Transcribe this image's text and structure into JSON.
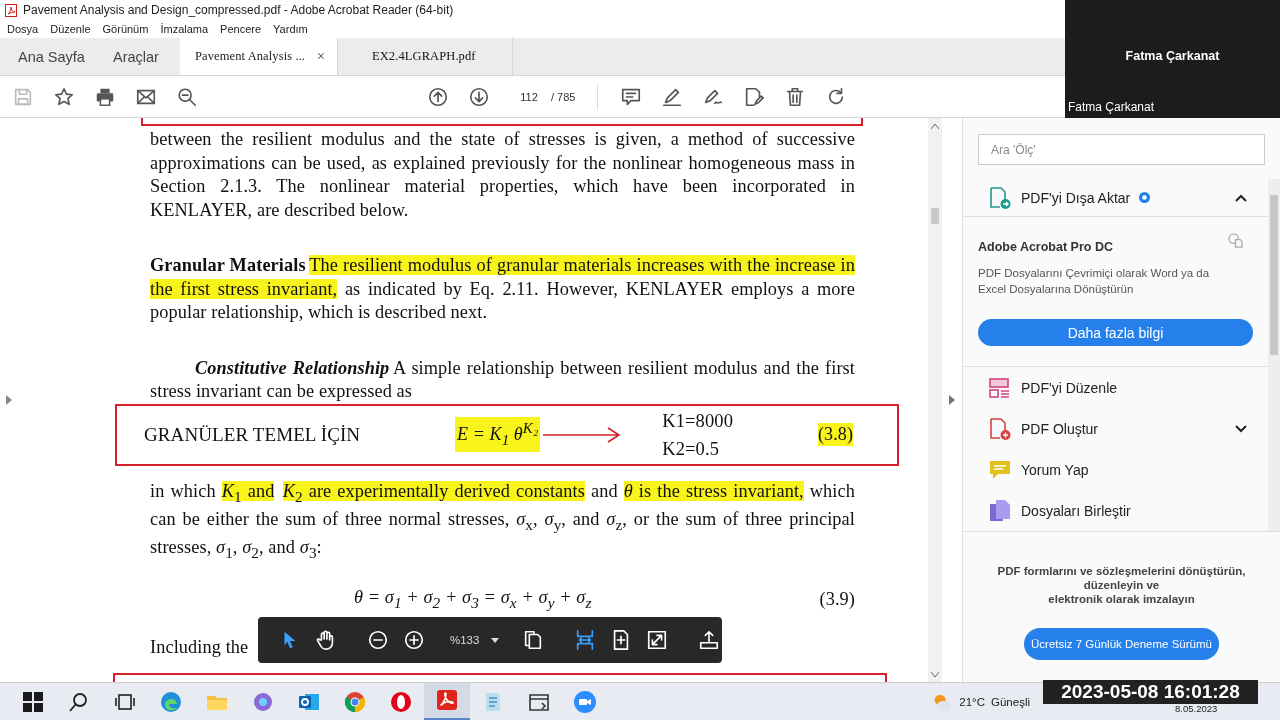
{
  "window": {
    "title": "Pavement Analysis and Design_compressed.pdf - Adobe Acrobat Reader (64-bit)"
  },
  "menu": [
    "Dosya",
    "Düzenle",
    "Görünüm",
    "İmzalama",
    "Pencere",
    "Yardım"
  ],
  "tabs": [
    {
      "label": "Ana Sayfa",
      "kind": "nav",
      "selected": false
    },
    {
      "label": "Araçlar",
      "kind": "nav",
      "selected": false
    },
    {
      "label": "Pavement Analysis ...",
      "kind": "doc",
      "selected": true,
      "close": "×"
    },
    {
      "label": "EX2.4LGRAPH.pdf",
      "kind": "doc",
      "selected": false
    }
  ],
  "toolbar": {
    "save": {
      "disabled": true
    },
    "page": "112",
    "total": "/ 785"
  },
  "participant": {
    "name": "Fatma Çarkanat",
    "caption": "Fatma Çarkanat"
  },
  "document": {
    "blocks": [
      {
        "kind": "frame_end"
      },
      {
        "kind": "paragraph",
        "segments": [
          {
            "text": "between the resilient modulus and the state of stresses is given, a method of successive approximations can be used, as explained previously for the nonlinear homogeneous mass in Section 2.1.3. The nonlinear material properties, which have been incorporated in KENLAYER, are described below.",
            "highlighted": false
          }
        ]
      },
      {
        "kind": "paragraph",
        "segments": [
          {
            "text": "**Granular Materials**",
            "highlighted": false
          },
          {
            "text": "The resilient modulus of granular materials increases with the increase in the first stress invariant,",
            "highlighted": true
          },
          {
            "text": " as indicated by Eq. 2.11. However, KENLAYER employs a more popular relationship, which is described next.",
            "highlighted": false
          }
        ]
      },
      {
        "kind": "paragraph",
        "indented": true,
        "segments": [
          {
            "text": "**Constitutive Relationship**",
            "highlighted": false
          },
          {
            "text": "A simple relationship between resilient modulus and the first stress invariant can be expressed as",
            "highlighted": false
          }
        ]
      },
      {
        "kind": "equation_box",
        "label": "GRANÜLER TEMEL İÇİN",
        "equation": "E = K$_{1}$ θ$^{K₂}$",
        "notes": [
          "K1=8000",
          "K2=0.5"
        ],
        "number": "(3.8)"
      },
      {
        "kind": "paragraph",
        "segments": [
          {
            "text": "in which ",
            "highlighted": false
          },
          {
            "text": "*K*$_{1}$ and",
            "highlighted": true
          },
          {
            "text": "*K*$_{2}$ are experimentally derived constants",
            "highlighted": true
          },
          {
            "text": " and ",
            "highlighted": false
          },
          {
            "text": "*θ* is the stress invariant,",
            "highlighted": true
          },
          {
            "text": " which can be either the sum of three normal stresses, *σ*$_{x}$, *σ*$_{y}$, and *σ*$_{z}$, or the sum of three principal stresses, *σ*$_{1}$, *σ*$_{2}$, and *σ*$_{3}$:",
            "highlighted": false
          }
        ]
      },
      {
        "kind": "equation",
        "equation": "θ = σ$_{1}$ + σ$_{2}$ + σ$_{3}$ = σ$_{x}$ + σ$_{y}$ + σ$_{z}$",
        "number": "(3.9)"
      },
      {
        "kind": "paragraph",
        "segments": [
          {
            "text": "Including the",
            "highlighted": false
          }
        ]
      },
      {
        "kind": "frame_start"
      }
    ]
  },
  "view_toolbar": {
    "items": [
      {
        "kind": "select",
        "selected": true
      },
      {
        "kind": "hand",
        "selected": false
      },
      {
        "kind": "separator"
      },
      {
        "kind": "zoom_out",
        "selected": false
      },
      {
        "kind": "zoom_in",
        "selected": false
      },
      {
        "kind": "zoom_level",
        "label": "%133"
      },
      {
        "kind": "pages",
        "selected": false
      },
      {
        "kind": "separator"
      },
      {
        "kind": "fit_width",
        "selected": true
      },
      {
        "kind": "fit_page",
        "selected": false
      },
      {
        "kind": "full_screen",
        "selected": false
      },
      {
        "kind": "separator"
      },
      {
        "kind": "share",
        "selected": false
      }
    ]
  },
  "right_panel": {
    "search": {
      "placeholder": "Ara 'Ölç'"
    },
    "export": {
      "label": "PDF'yi Dışa Aktar",
      "expanded": true,
      "card_title": "Adobe Acrobat Pro DC",
      "description": "PDF Dosyalarını Çevrimiçi olarak Word ya da Excel Dosyalarına Dönüştürün",
      "button": "Daha fazla bilgi"
    },
    "tools": [
      {
        "label": "PDF'yi Düzenle",
        "kind": "edit"
      },
      {
        "label": "PDF Oluştur",
        "kind": "create",
        "expanded": false
      },
      {
        "label": "Yorum Yap",
        "kind": "comment"
      },
      {
        "label": "Dosyaları Birleştir",
        "kind": "combine"
      }
    ],
    "promo": {
      "lines": [
        "PDF formlarını ve sözleşmelerini dönüştürün,",
        "düzenleyin ve",
        "elektronik olarak imzalayın"
      ],
      "button": "Ücretsiz 7 Günlük Deneme Sürümü"
    }
  },
  "taskbar": {
    "apps": [
      {
        "kind": "start",
        "active": false
      },
      {
        "kind": "search",
        "active": false
      },
      {
        "kind": "task_view",
        "active": false
      },
      {
        "kind": "edge",
        "active": false
      },
      {
        "kind": "folder",
        "active": false
      },
      {
        "kind": "photos",
        "active": false
      },
      {
        "kind": "outlook",
        "active": false
      },
      {
        "kind": "chrome",
        "active": false
      },
      {
        "kind": "opera",
        "active": false
      },
      {
        "kind": "acrobat",
        "active": true
      },
      {
        "kind": "notepad",
        "active": false
      },
      {
        "kind": "window",
        "active": false
      },
      {
        "kind": "zoom",
        "active": false
      }
    ],
    "temperature": "21°C",
    "weather": "Güneşli",
    "date": "8.05.2023"
  },
  "recording_timestamp": "2023-05-08 16:01:28"
}
